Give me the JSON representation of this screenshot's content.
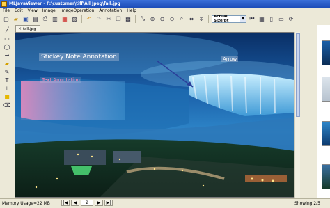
{
  "window": {
    "title": "MLJavaViewer - F:\\customer\\tiff\\All Jpeg\\fall.jpg"
  },
  "menu": [
    "File",
    "Edit",
    "View",
    "Image",
    "ImageOperation",
    "Annotation",
    "Help"
  ],
  "toolbar": {
    "icons": [
      "new-icon",
      "open-icon",
      "save-icon",
      "save-as-icon",
      "print-icon",
      "scan-icon",
      "pdf-icon",
      "print-preview-icon",
      "undo-icon",
      "redo-icon",
      "cut-icon",
      "copy-icon",
      "paste-icon",
      "select-icon",
      "zoom-in-icon",
      "zoom-out-icon",
      "zoom-fit-icon",
      "zoom-window-icon",
      "fit-width-icon",
      "fit-height-icon"
    ],
    "size_select": "Actual Size/bt"
  },
  "left_tools": [
    "line-icon",
    "rectangle-icon",
    "ellipse-icon",
    "arrow-icon",
    "highlight-icon",
    "pen-icon",
    "text-icon",
    "stamp-icon",
    "note-icon",
    "eraser-icon"
  ],
  "tab": {
    "label": "fall.jpg"
  },
  "annotations": {
    "sticky": "Stickey Note Annotation",
    "text": "Text Annotation",
    "arrow": "Arrow"
  },
  "status": {
    "memory": "Memory Usage=22 MB",
    "page": "2",
    "total": "5",
    "showing": "Showing 2/5"
  }
}
